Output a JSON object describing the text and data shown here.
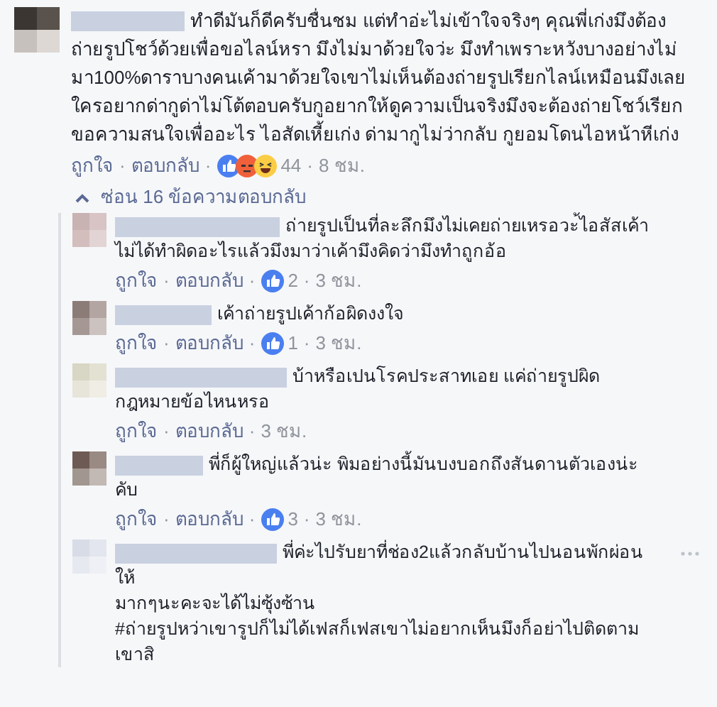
{
  "separator": "·",
  "comment": {
    "text": "ทำดีมันก็ดีครับชื่นชม แต่ทำอ่ะไม่เข้าใจจริงๆ คุณพี่เก่งมึงต้องถ่ายรูปโชว์ด้วยเพื่อขอไลน์หรา มึงไม่มาด้วยใจว่ะ มึงทำเพราะหวังบางอย่างไม่มา100%ดาราบางคนเค้ามาด้วยใจเขาไม่เห็นต้องถ่ายรูปเรียกไลน์เหมือนมึงเลย ใครอยากด่ากูด่าไม่โต้ตอบครับกูอยากให้ดูความเป็นจริงมึงจะต้องถ่ายโชว์เรียกขอความสนใจเพื่ออะไร ไอสัดเหี้ยเก่ง ด่ามากูไม่ว่ากลับ กูยอมโดนไอหน้าหีเก่ง",
    "actions": [
      "ถูกใจ",
      "ตอบกลับ"
    ],
    "reactions": [
      {
        "kind": "like"
      },
      {
        "kind": "angry"
      },
      {
        "kind": "haha"
      }
    ],
    "count": "44",
    "time": "8 ชม."
  },
  "hide_replies": "ซ่อน 16 ข้อความตอบกลับ",
  "replies": [
    {
      "text": "ถ่ายรูปเป็นที่ละลึกมึงไม่เคยถ่ายเหรอวะ้ไอสัสเค้าไม่ได้ทำผิดอะไรแล้วมึงมาว่าเค้ามึงคิดว่ามึงทำถูกอ้อ",
      "actions": [
        "ถูกใจ",
        "ตอบกลับ"
      ],
      "reactions": [
        {
          "kind": "like"
        }
      ],
      "count": "2",
      "time": "3 ชม."
    },
    {
      "text": "เค้าถ่ายรูปเค้าก้อผิดงงใจ",
      "actions": [
        "ถูกใจ",
        "ตอบกลับ"
      ],
      "reactions": [
        {
          "kind": "like"
        }
      ],
      "count": "1",
      "time": "3 ชม."
    },
    {
      "text": "บ้าหรือเปนโรคประสาทเอย แค่ถ่ายรูปผิดกฎหมายข้อไหนหรอ",
      "actions": [
        "ถูกใจ",
        "ตอบกลับ"
      ],
      "time": "3 ชม."
    },
    {
      "text": "พี่ก็ผู้ใหญ่แล้วน่ะ พิมอย่างนี้มันบงบอกถึงสันดานตัวเองน่ะคับ",
      "actions": [
        "ถูกใจ",
        "ตอบกลับ"
      ],
      "reactions": [
        {
          "kind": "like"
        }
      ],
      "count": "3",
      "time": "3 ชม."
    },
    {
      "text": "พี่ค่ะไปรับยาที่ช่อง2แล้วกลับบ้านไปนอนพักผ่อนให้\nมากๆนะคะจะได้ไม่ซุ้งซ้าน\n#ถ่ายรูปหว่าเขารูปก็ไม่ได้เฟสก็เฟสเขาไม่อยากเห็นมึงก็อย่าไปติดตามเขาสิ",
      "has_menu": true
    }
  ]
}
